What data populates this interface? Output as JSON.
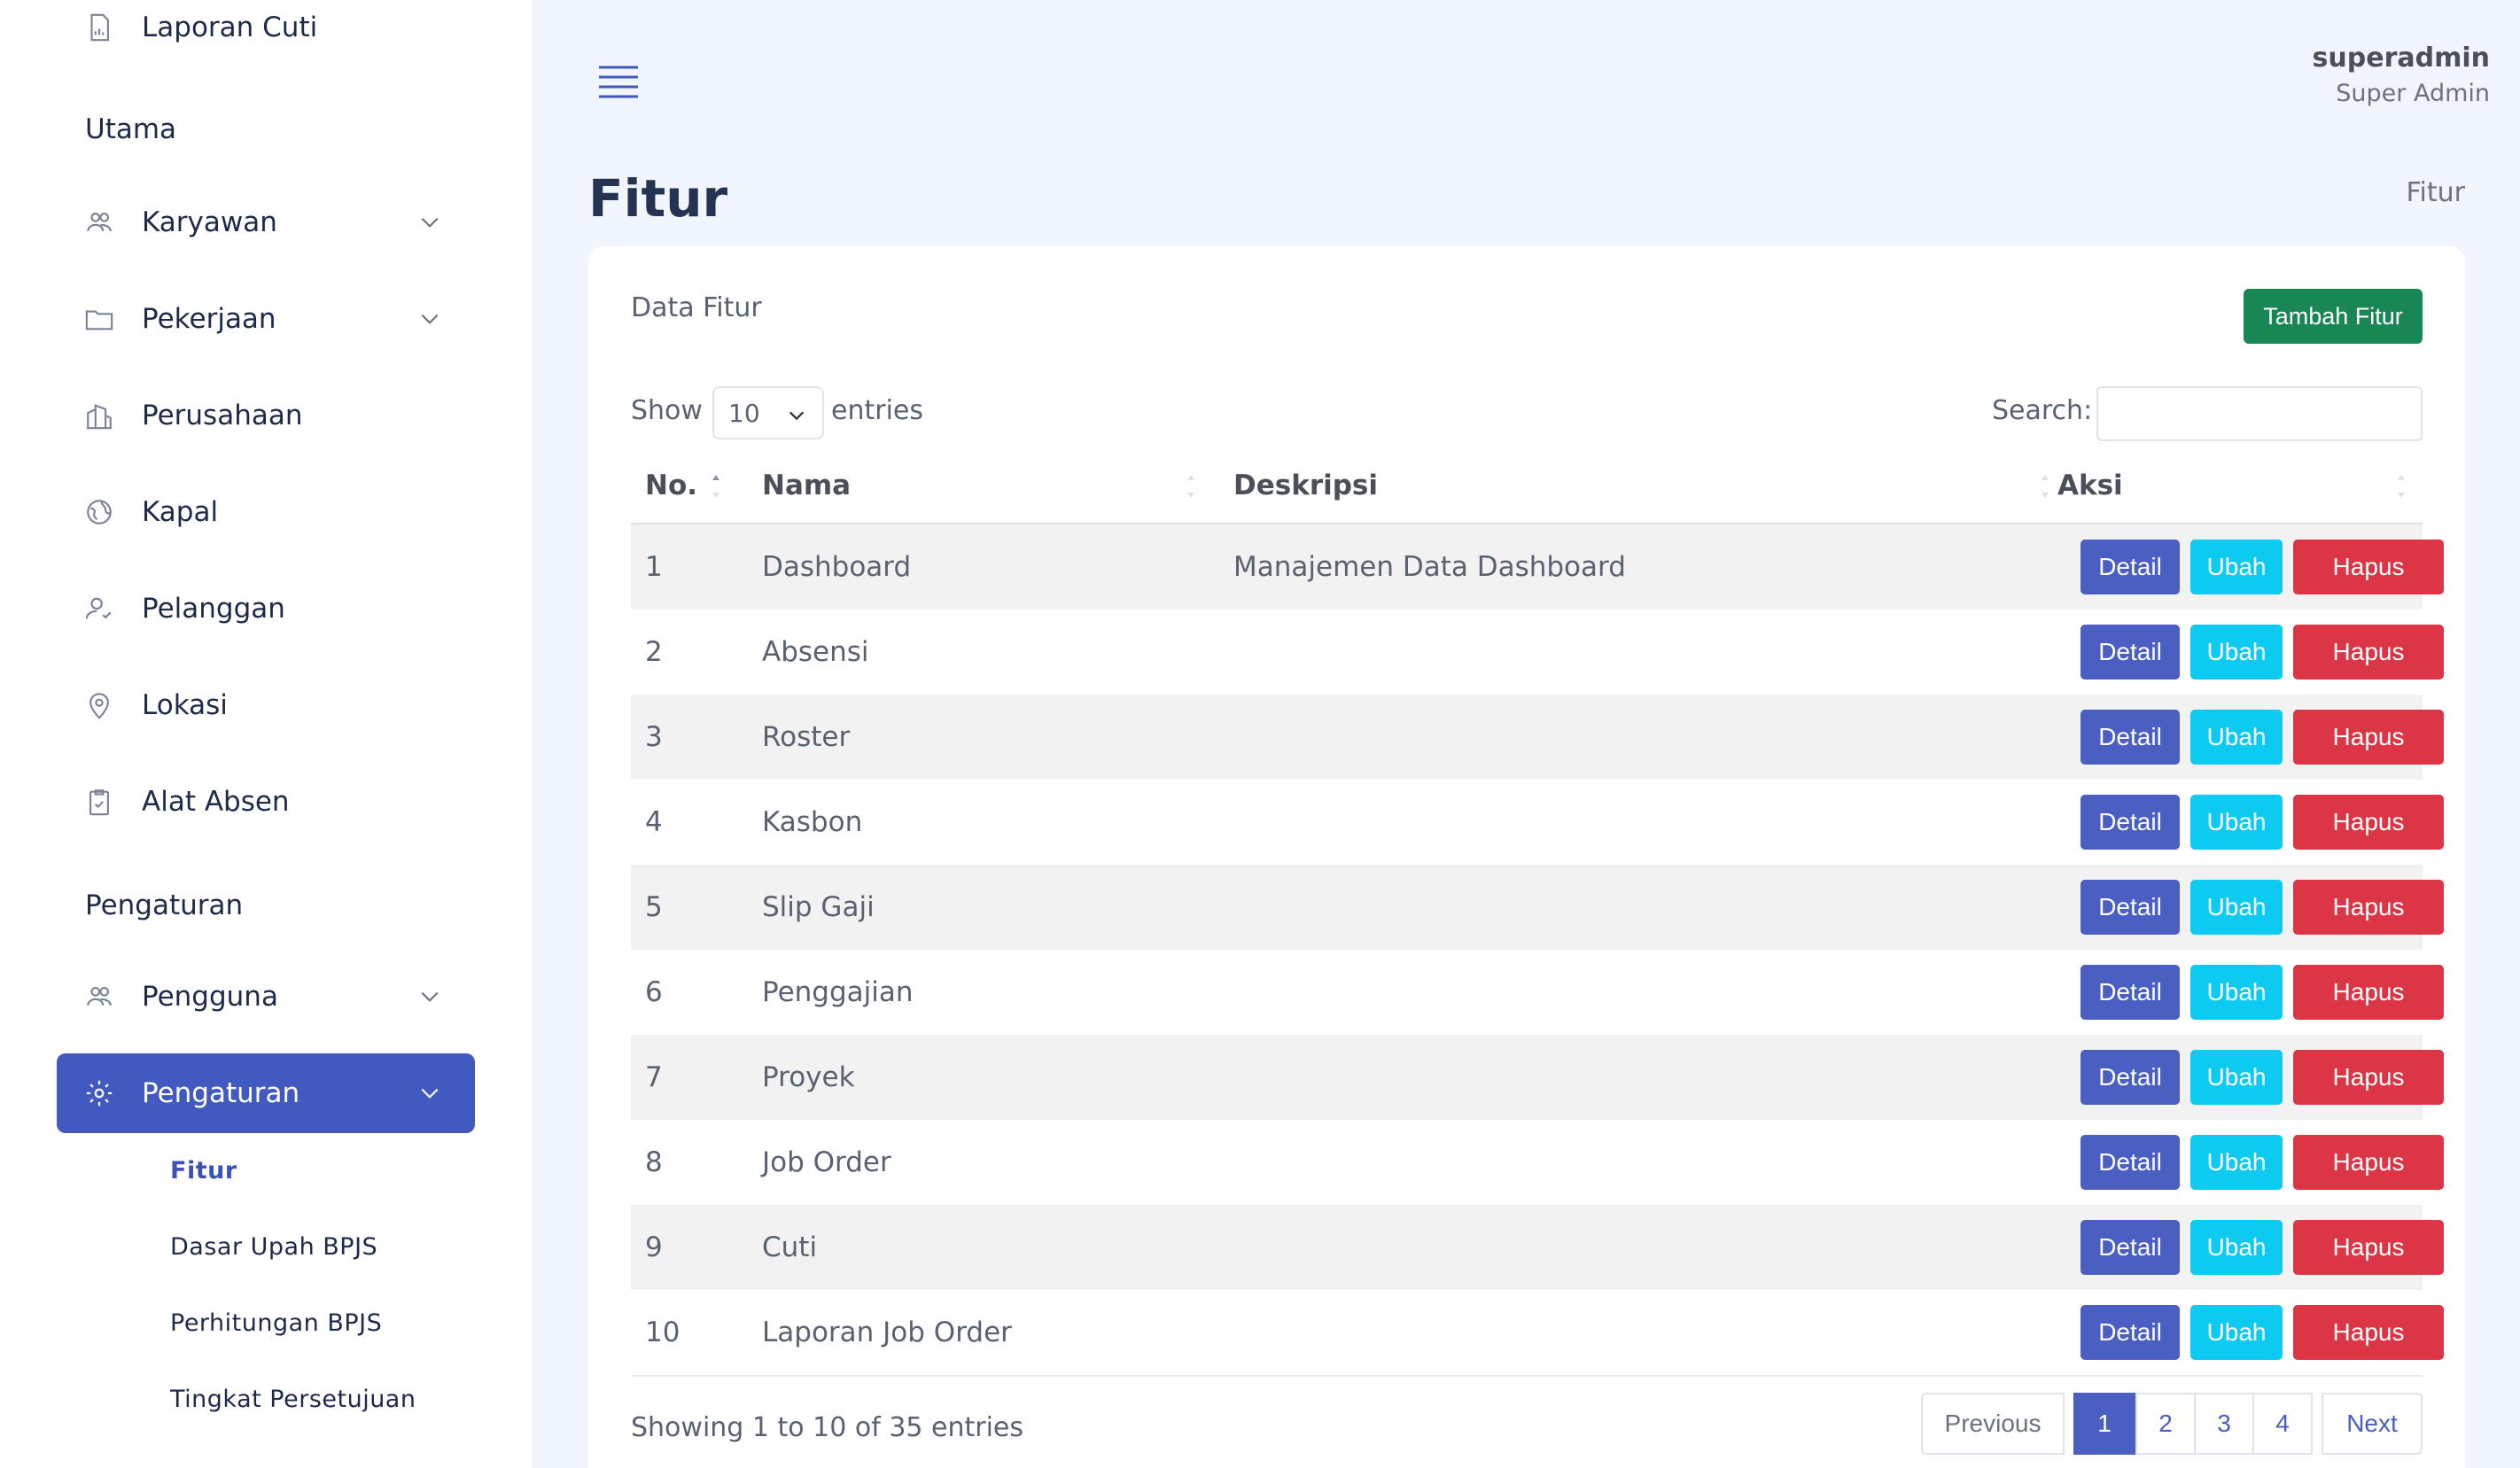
{
  "sidebar": {
    "top_item": "Laporan Cuti",
    "section_utama": "Utama",
    "items": [
      {
        "label": "Karyawan",
        "icon": "users-icon"
      },
      {
        "label": "Pekerjaan",
        "icon": "folder-icon"
      },
      {
        "label": "Perusahaan",
        "icon": "building-icon"
      },
      {
        "label": "Kapal",
        "icon": "globe-icon"
      },
      {
        "label": "Pelanggan",
        "icon": "user-check-icon"
      },
      {
        "label": "Lokasi",
        "icon": "map-pin-icon"
      },
      {
        "label": "Alat Absen",
        "icon": "clipboard-icon"
      }
    ],
    "section_pengaturan": "Pengaturan",
    "pengguna": "Pengguna",
    "pengaturan": "Pengaturan",
    "sub_items": [
      "Fitur",
      "Dasar Upah BPJS",
      "Perhitungan BPJS",
      "Tingkat Persetujuan"
    ]
  },
  "header": {
    "user_name": "superadmin",
    "user_role": "Super Admin"
  },
  "page": {
    "title": "Fitur",
    "breadcrumb": "Fitur"
  },
  "card": {
    "title": "Data Fitur",
    "add_button": "Tambah Fitur",
    "show_label": "Show",
    "show_value": "10",
    "entries_label": "entries",
    "search_label": "Search:"
  },
  "table": {
    "columns": [
      "No.",
      "Nama",
      "Deskripsi",
      "Aksi"
    ],
    "rows": [
      {
        "no": "1",
        "nama": "Dashboard",
        "deskripsi": "Manajemen Data Dashboard"
      },
      {
        "no": "2",
        "nama": "Absensi",
        "deskripsi": ""
      },
      {
        "no": "3",
        "nama": "Roster",
        "deskripsi": ""
      },
      {
        "no": "4",
        "nama": "Kasbon",
        "deskripsi": ""
      },
      {
        "no": "5",
        "nama": "Slip Gaji",
        "deskripsi": ""
      },
      {
        "no": "6",
        "nama": "Penggajian",
        "deskripsi": ""
      },
      {
        "no": "7",
        "nama": "Proyek",
        "deskripsi": ""
      },
      {
        "no": "8",
        "nama": "Job Order",
        "deskripsi": ""
      },
      {
        "no": "9",
        "nama": "Cuti",
        "deskripsi": ""
      },
      {
        "no": "10",
        "nama": "Laporan Job Order",
        "deskripsi": ""
      }
    ],
    "actions": {
      "detail": "Detail",
      "ubah": "Ubah",
      "hapus": "Hapus"
    }
  },
  "footer": {
    "showing": "Showing 1 to 10 of 35 entries",
    "prev": "Previous",
    "pages": [
      "1",
      "2",
      "3",
      "4"
    ],
    "next": "Next"
  },
  "colors": {
    "primary": "#4a5fc1",
    "success": "#198754",
    "info": "#0dcaf0",
    "danger": "#dc3545"
  }
}
